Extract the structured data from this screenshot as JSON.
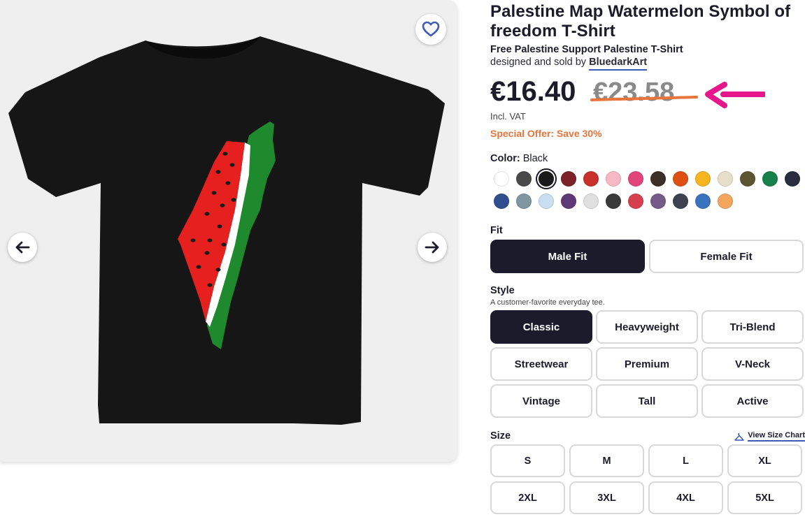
{
  "product": {
    "title": "Palestine Map Watermelon Symbol of freedom T-Shirt",
    "subtitle": "Free Palestine Support Palestine T-Shirt",
    "designed_by_prefix": "designed and sold by",
    "artist": "BluedarkArt"
  },
  "pricing": {
    "price": "€16.40",
    "original_price": "€23.58",
    "vat_note": "Incl. VAT",
    "offer": "Special Offer: Save 30%",
    "offer_color": "#e8743b"
  },
  "color": {
    "label": "Color:",
    "selected": "Black",
    "swatches_row1": [
      "#ffffff",
      "#4a4a4a",
      "#1a1a1a",
      "#7a2328",
      "#c8302a",
      "#f6b8c4",
      "#e2457a",
      "#3b2f28",
      "#dd4f12",
      "#f5b520",
      "#e8dfc8",
      "#5c5532",
      "#15804a",
      "#282c3e"
    ],
    "swatches_row2": [
      "#2f4f8f",
      "#7f97a0",
      "#c7dff0",
      "#5f3878",
      "#e0e0e0",
      "#3a3a3a",
      "#d4404e",
      "#755b8a",
      "#3d4150",
      "#3a72c0",
      "#f4a661"
    ]
  },
  "fit": {
    "label": "Fit",
    "options": [
      "Male Fit",
      "Female Fit"
    ],
    "selected": "Male Fit"
  },
  "style": {
    "label": "Style",
    "description": "A customer-favorite everyday tee.",
    "options": [
      "Classic",
      "Heavyweight",
      "Tri-Blend",
      "Streetwear",
      "Premium",
      "V-Neck",
      "Vintage",
      "Tall",
      "Active"
    ],
    "selected": "Classic"
  },
  "size": {
    "label": "Size",
    "chart_link": "View Size Chart",
    "options": [
      "S",
      "M",
      "L",
      "XL",
      "2XL",
      "3XL",
      "4XL",
      "5XL"
    ]
  },
  "icons": {
    "favorite": "heart-icon",
    "prev": "arrow-left-icon",
    "next": "arrow-right-icon",
    "size_chart": "hanger-icon",
    "annotation": "pink-arrow-annotation"
  },
  "colors": {
    "primary_dark": "#1c1b2b",
    "link_underline": "#3b5bb5",
    "annotation_pink": "#e6178a"
  }
}
